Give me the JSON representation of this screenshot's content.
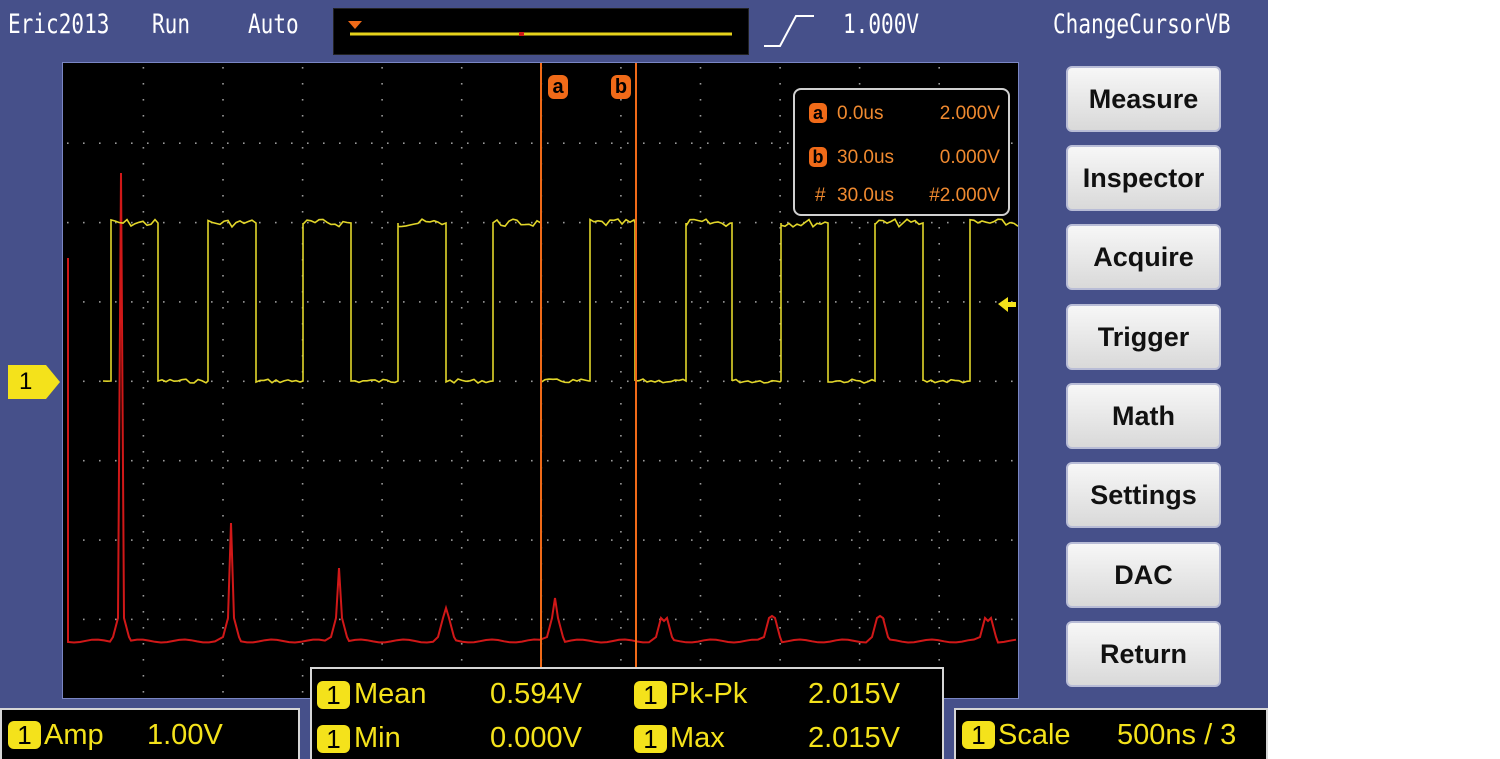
{
  "header": {
    "device_name": "Eric2013",
    "run_state": "Run",
    "trigger_mode": "Auto",
    "trigger_level": "1.000V",
    "menu_title": "ChangeCursorVB"
  },
  "menu": {
    "buttons": [
      "Measure",
      "Inspector",
      "Acquire",
      "Trigger",
      "Math",
      "Settings",
      "DAC",
      "Return"
    ]
  },
  "channel": {
    "label": "1",
    "amp_label": "Amp",
    "amp_value": "1.00V",
    "scale_label": "Scale",
    "scale_value": "500ns / 3"
  },
  "measurements": {
    "mean_label": "Mean",
    "mean_value": "0.594V",
    "pkpk_label": "Pk-Pk",
    "pkpk_value": "2.015V",
    "min_label": "Min",
    "min_value": "0.000V",
    "max_label": "Max",
    "max_value": "2.015V"
  },
  "cursors": {
    "a_label": "a",
    "a_time": "0.0us",
    "a_volt": "2.000V",
    "b_label": "b",
    "b_time": "30.0us",
    "b_volt": "0.000V",
    "delta_label": "#",
    "delta_time": "30.0us",
    "delta_volt": "#2.000V"
  },
  "colors": {
    "background": "#46508a",
    "channel1": "#f4e21b",
    "fft_trace": "#d01818",
    "cursor": "#f06a18",
    "grid": "#9a9a9a"
  },
  "icons": {
    "trigger_edge": "rising-edge-icon",
    "trigger_level_arrow": "left-arrow-icon"
  }
}
